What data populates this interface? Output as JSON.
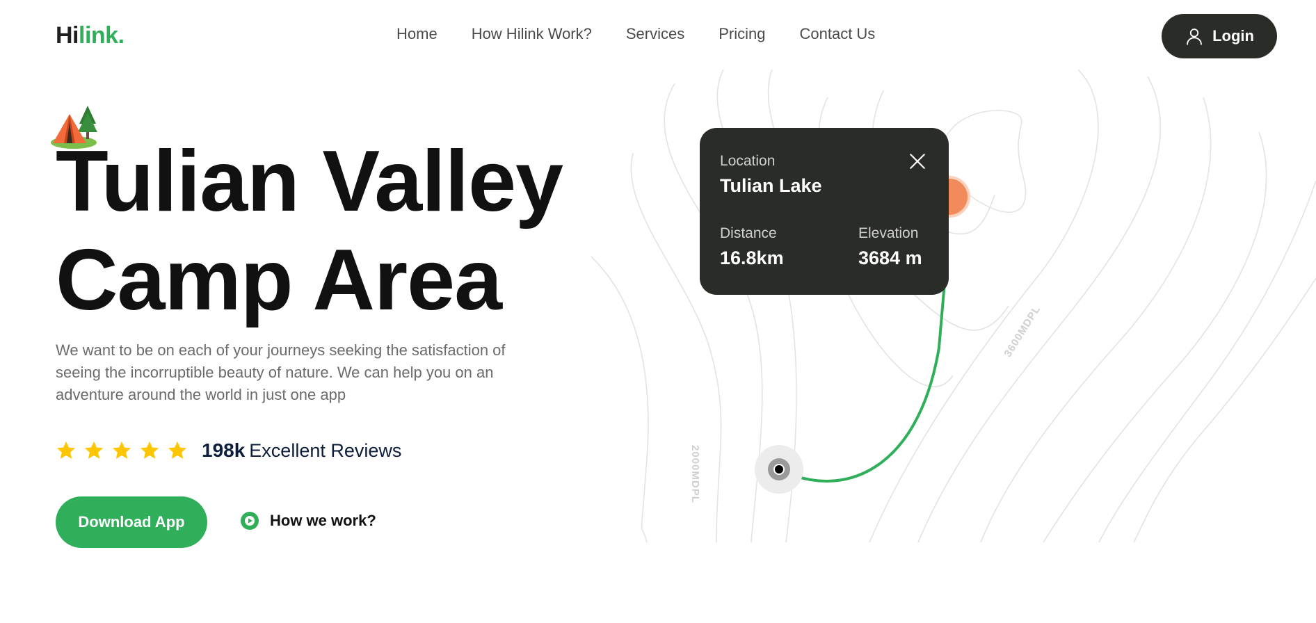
{
  "brand": {
    "logo_prefix": "Hi",
    "logo_accent": "link.",
    "accent_color": "#30af5b",
    "dark_color": "#292c27"
  },
  "nav": {
    "items": [
      {
        "label": "Home"
      },
      {
        "label": "How Hilink Work?"
      },
      {
        "label": "Services"
      },
      {
        "label": "Pricing"
      },
      {
        "label": "Contact Us"
      }
    ],
    "login_label": "Login",
    "login_icon": "user-icon"
  },
  "hero": {
    "decoration_icon": "camp-tent-icon",
    "title_line1": "Tulian Valley",
    "title_line2": "Camp Area",
    "description": "We want to be on each of your journeys seeking the satisfaction of seeing the incorruptible beauty of nature. We can help you on an adventure around the world in just one app",
    "rating": {
      "stars": 5,
      "count": "198k",
      "label": "Excellent Reviews",
      "star_color": "#fec601"
    },
    "download_label": "Download App",
    "how_label": "How we work?",
    "how_icon": "play-icon"
  },
  "map": {
    "card": {
      "location_label": "Location",
      "location_value": "Tulian Lake",
      "distance_label": "Distance",
      "distance_value": "16.8km",
      "elevation_label": "Elevation",
      "elevation_value": "3684 m",
      "close_icon": "close-icon"
    },
    "contour_labels": [
      "3600MDPL",
      "2000MDPL"
    ],
    "route_color": "#30af5b"
  }
}
